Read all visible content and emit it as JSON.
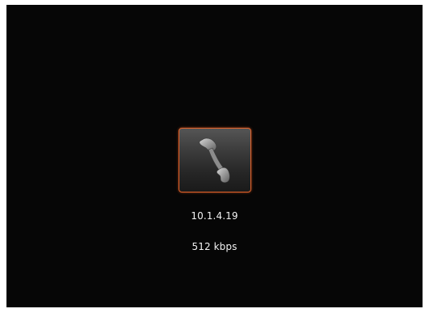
{
  "call": {
    "icon": "phone-handset-icon",
    "accent_color": "#e8642a",
    "background_color": "#060606",
    "address": "10.1.4.19",
    "bitrate": "512 kbps"
  }
}
